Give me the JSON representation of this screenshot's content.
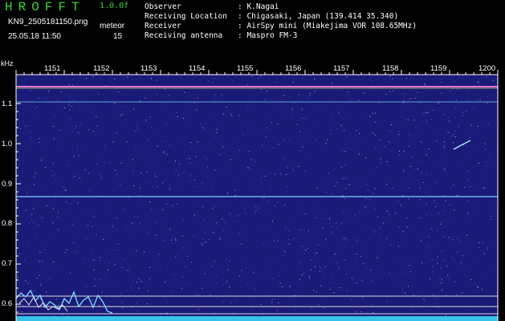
{
  "header": {
    "app_title": "HROFFT",
    "version": "1.0.0f",
    "filename": "KN9_2505181150.png",
    "meteor_label": "meteor",
    "datetime": "25.05.18 11:50",
    "meteor_count": "15"
  },
  "info": [
    {
      "label": "Observer",
      "value": ": K.Nagai"
    },
    {
      "label": "Receiving Location",
      "value": ": Chigasaki, Japan (139.414 35.340)"
    },
    {
      "label": "Receiver",
      "value": ": AirSpy mini (Miakejima VOR 108.65MHz)"
    },
    {
      "label": "Receiving antenna",
      "value": ": Maspro FM-3"
    }
  ],
  "axis": {
    "unit": "kHz",
    "x_ticks": [
      "1151",
      "1152",
      "1153",
      "1154",
      "1155",
      "1156",
      "1157",
      "1158",
      "1159",
      "1200"
    ],
    "y_ticks": [
      "1.1",
      "1.0",
      "0.9",
      "0.8",
      "0.7",
      "0.6"
    ]
  },
  "colors": {
    "background": "#000000",
    "spectrum_bg": "#1a1a78",
    "title_green": "#2fd92f",
    "carrier": "#e0409a",
    "trace": "#7fdfff"
  }
}
